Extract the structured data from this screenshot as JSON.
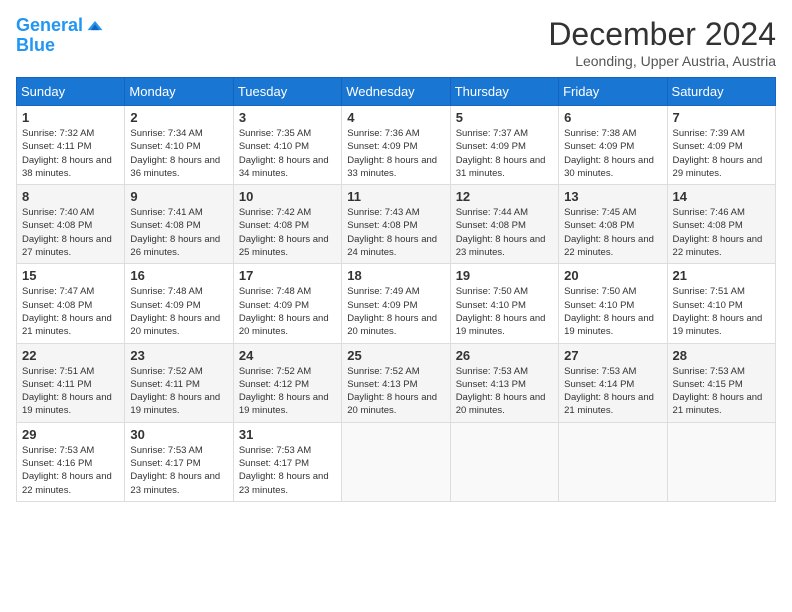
{
  "header": {
    "logo_line1": "General",
    "logo_line2": "Blue",
    "month": "December 2024",
    "location": "Leonding, Upper Austria, Austria"
  },
  "weekdays": [
    "Sunday",
    "Monday",
    "Tuesday",
    "Wednesday",
    "Thursday",
    "Friday",
    "Saturday"
  ],
  "weeks": [
    [
      {
        "day": "1",
        "sunrise": "Sunrise: 7:32 AM",
        "sunset": "Sunset: 4:11 PM",
        "daylight": "Daylight: 8 hours and 38 minutes."
      },
      {
        "day": "2",
        "sunrise": "Sunrise: 7:34 AM",
        "sunset": "Sunset: 4:10 PM",
        "daylight": "Daylight: 8 hours and 36 minutes."
      },
      {
        "day": "3",
        "sunrise": "Sunrise: 7:35 AM",
        "sunset": "Sunset: 4:10 PM",
        "daylight": "Daylight: 8 hours and 34 minutes."
      },
      {
        "day": "4",
        "sunrise": "Sunrise: 7:36 AM",
        "sunset": "Sunset: 4:09 PM",
        "daylight": "Daylight: 8 hours and 33 minutes."
      },
      {
        "day": "5",
        "sunrise": "Sunrise: 7:37 AM",
        "sunset": "Sunset: 4:09 PM",
        "daylight": "Daylight: 8 hours and 31 minutes."
      },
      {
        "day": "6",
        "sunrise": "Sunrise: 7:38 AM",
        "sunset": "Sunset: 4:09 PM",
        "daylight": "Daylight: 8 hours and 30 minutes."
      },
      {
        "day": "7",
        "sunrise": "Sunrise: 7:39 AM",
        "sunset": "Sunset: 4:09 PM",
        "daylight": "Daylight: 8 hours and 29 minutes."
      }
    ],
    [
      {
        "day": "8",
        "sunrise": "Sunrise: 7:40 AM",
        "sunset": "Sunset: 4:08 PM",
        "daylight": "Daylight: 8 hours and 27 minutes."
      },
      {
        "day": "9",
        "sunrise": "Sunrise: 7:41 AM",
        "sunset": "Sunset: 4:08 PM",
        "daylight": "Daylight: 8 hours and 26 minutes."
      },
      {
        "day": "10",
        "sunrise": "Sunrise: 7:42 AM",
        "sunset": "Sunset: 4:08 PM",
        "daylight": "Daylight: 8 hours and 25 minutes."
      },
      {
        "day": "11",
        "sunrise": "Sunrise: 7:43 AM",
        "sunset": "Sunset: 4:08 PM",
        "daylight": "Daylight: 8 hours and 24 minutes."
      },
      {
        "day": "12",
        "sunrise": "Sunrise: 7:44 AM",
        "sunset": "Sunset: 4:08 PM",
        "daylight": "Daylight: 8 hours and 23 minutes."
      },
      {
        "day": "13",
        "sunrise": "Sunrise: 7:45 AM",
        "sunset": "Sunset: 4:08 PM",
        "daylight": "Daylight: 8 hours and 22 minutes."
      },
      {
        "day": "14",
        "sunrise": "Sunrise: 7:46 AM",
        "sunset": "Sunset: 4:08 PM",
        "daylight": "Daylight: 8 hours and 22 minutes."
      }
    ],
    [
      {
        "day": "15",
        "sunrise": "Sunrise: 7:47 AM",
        "sunset": "Sunset: 4:08 PM",
        "daylight": "Daylight: 8 hours and 21 minutes."
      },
      {
        "day": "16",
        "sunrise": "Sunrise: 7:48 AM",
        "sunset": "Sunset: 4:09 PM",
        "daylight": "Daylight: 8 hours and 20 minutes."
      },
      {
        "day": "17",
        "sunrise": "Sunrise: 7:48 AM",
        "sunset": "Sunset: 4:09 PM",
        "daylight": "Daylight: 8 hours and 20 minutes."
      },
      {
        "day": "18",
        "sunrise": "Sunrise: 7:49 AM",
        "sunset": "Sunset: 4:09 PM",
        "daylight": "Daylight: 8 hours and 20 minutes."
      },
      {
        "day": "19",
        "sunrise": "Sunrise: 7:50 AM",
        "sunset": "Sunset: 4:10 PM",
        "daylight": "Daylight: 8 hours and 19 minutes."
      },
      {
        "day": "20",
        "sunrise": "Sunrise: 7:50 AM",
        "sunset": "Sunset: 4:10 PM",
        "daylight": "Daylight: 8 hours and 19 minutes."
      },
      {
        "day": "21",
        "sunrise": "Sunrise: 7:51 AM",
        "sunset": "Sunset: 4:10 PM",
        "daylight": "Daylight: 8 hours and 19 minutes."
      }
    ],
    [
      {
        "day": "22",
        "sunrise": "Sunrise: 7:51 AM",
        "sunset": "Sunset: 4:11 PM",
        "daylight": "Daylight: 8 hours and 19 minutes."
      },
      {
        "day": "23",
        "sunrise": "Sunrise: 7:52 AM",
        "sunset": "Sunset: 4:11 PM",
        "daylight": "Daylight: 8 hours and 19 minutes."
      },
      {
        "day": "24",
        "sunrise": "Sunrise: 7:52 AM",
        "sunset": "Sunset: 4:12 PM",
        "daylight": "Daylight: 8 hours and 19 minutes."
      },
      {
        "day": "25",
        "sunrise": "Sunrise: 7:52 AM",
        "sunset": "Sunset: 4:13 PM",
        "daylight": "Daylight: 8 hours and 20 minutes."
      },
      {
        "day": "26",
        "sunrise": "Sunrise: 7:53 AM",
        "sunset": "Sunset: 4:13 PM",
        "daylight": "Daylight: 8 hours and 20 minutes."
      },
      {
        "day": "27",
        "sunrise": "Sunrise: 7:53 AM",
        "sunset": "Sunset: 4:14 PM",
        "daylight": "Daylight: 8 hours and 21 minutes."
      },
      {
        "day": "28",
        "sunrise": "Sunrise: 7:53 AM",
        "sunset": "Sunset: 4:15 PM",
        "daylight": "Daylight: 8 hours and 21 minutes."
      }
    ],
    [
      {
        "day": "29",
        "sunrise": "Sunrise: 7:53 AM",
        "sunset": "Sunset: 4:16 PM",
        "daylight": "Daylight: 8 hours and 22 minutes."
      },
      {
        "day": "30",
        "sunrise": "Sunrise: 7:53 AM",
        "sunset": "Sunset: 4:17 PM",
        "daylight": "Daylight: 8 hours and 23 minutes."
      },
      {
        "day": "31",
        "sunrise": "Sunrise: 7:53 AM",
        "sunset": "Sunset: 4:17 PM",
        "daylight": "Daylight: 8 hours and 23 minutes."
      },
      null,
      null,
      null,
      null
    ]
  ]
}
